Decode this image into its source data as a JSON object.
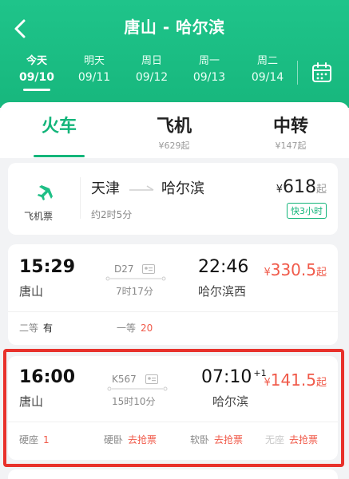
{
  "header": {
    "title": "唐山 - 哈尔滨",
    "dates": [
      {
        "weekday": "今天",
        "date": "09/10",
        "active": true
      },
      {
        "weekday": "明天",
        "date": "09/11"
      },
      {
        "weekday": "周日",
        "date": "09/12"
      },
      {
        "weekday": "周一",
        "date": "09/13"
      },
      {
        "weekday": "周二",
        "date": "09/14"
      }
    ],
    "icons": {
      "back": "back-arrow-icon",
      "calendar": "calendar-icon"
    }
  },
  "modes": [
    {
      "label": "火车",
      "price": "",
      "active": true
    },
    {
      "label": "飞机",
      "price": "¥629起"
    },
    {
      "label": "中转",
      "price": "¥147起"
    }
  ],
  "flight": {
    "icon_label": "飞机票",
    "from": "天津",
    "to": "哈尔滨",
    "duration": "约2时5分",
    "currency": "¥",
    "price": "618",
    "price_suffix": "起",
    "badge": "快3小时"
  },
  "trains": [
    {
      "dep_time": "15:29",
      "dep_station": "唐山",
      "train_no": "D27",
      "duration": "7时17分",
      "arr_time": "22:46",
      "arr_day": "",
      "arr_station": "哈尔滨西",
      "currency": "¥",
      "price": "330.5",
      "price_suffix": "起",
      "seats": [
        {
          "type": "二等",
          "count": "有"
        },
        {
          "type": "一等",
          "count": "20"
        }
      ]
    },
    {
      "dep_time": "16:00",
      "dep_station": "唐山",
      "train_no": "K567",
      "duration": "15时10分",
      "arr_time": "07:10",
      "arr_day": "+1",
      "arr_station": "哈尔滨",
      "currency": "¥",
      "price": "141.5",
      "price_suffix": "起",
      "seats": [
        {
          "type": "硬座",
          "count": "1"
        },
        {
          "type": "硬卧",
          "count": "去抢票"
        },
        {
          "type": "软卧",
          "count": "去抢票"
        },
        {
          "type": "无座",
          "count": "去抢票"
        }
      ]
    }
  ],
  "colors": {
    "brand_green": "#13b57a",
    "header_green": "#1fc48a",
    "price_red": "#f05a4a",
    "highlight_red": "#e8312b"
  }
}
